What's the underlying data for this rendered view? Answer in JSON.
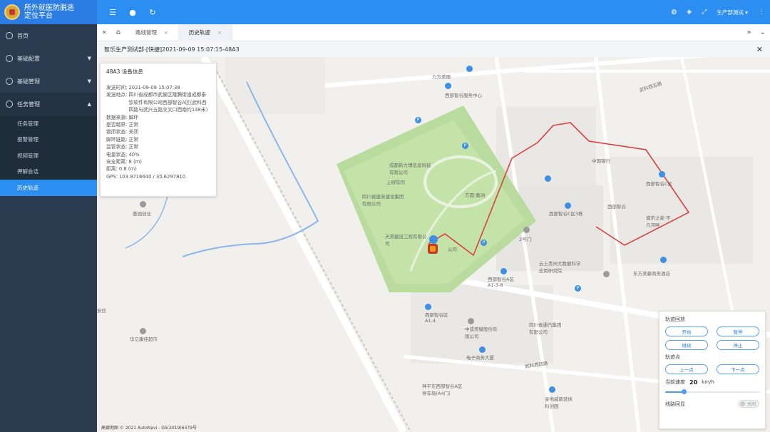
{
  "app": {
    "title_line1": "所外就医防脱逃",
    "title_line2": "定位平台"
  },
  "sidebar": {
    "items": [
      {
        "label": "首页"
      },
      {
        "label": "基础配置"
      },
      {
        "label": "基础管理"
      },
      {
        "label": "任务管理"
      }
    ],
    "submenu": [
      {
        "label": "任务管理"
      },
      {
        "label": "报警管理"
      },
      {
        "label": "视频管理"
      },
      {
        "label": "押解会话"
      },
      {
        "label": "历史轨迹"
      }
    ]
  },
  "topbar": {
    "user": "生产部测试"
  },
  "tabs": [
    {
      "label": "路线管理"
    },
    {
      "label": "历史轨迹"
    }
  ],
  "page": {
    "title": "智乐生产测试部-[快捷]2021-09-09 15:07:15-48A3"
  },
  "info": {
    "title": "48A3 设备信息",
    "rows": [
      {
        "k": "发送时间:",
        "v": "2021-09-09 15:07:38"
      },
      {
        "k": "发送地点:",
        "v": "四川省成都市武侯区隆腾街道成都泰钦软件有限公司西部智谷A区(武科西四路与武兴五路交叉口西南约148米)"
      },
      {
        "k": "数据来源:",
        "v": "脚环"
      },
      {
        "k": "是否越界:",
        "v": "正常"
      },
      {
        "k": "锁闭状态:",
        "v": "关闭"
      },
      {
        "k": "脚环链路:",
        "v": "正常"
      },
      {
        "k": "监管状态:",
        "v": "正常"
      },
      {
        "k": "电量状态:",
        "v": "40%"
      },
      {
        "k": "安全距离:",
        "v": "8 (m)"
      },
      {
        "k": "距离:",
        "v": "0.8 (m)"
      },
      {
        "k": "GPS:",
        "v": "103.9716640 / 30.6297810"
      }
    ]
  },
  "map": {
    "copyright": "高德地图 © 2021 AutoNavi - GS(2019)6379号",
    "labels": [
      "力方美丽",
      "西部智谷服务中心",
      "成都新力博信息科技有限公司",
      "上研院司",
      "四川省建安建设集团有限公司",
      "方圆·嘉洲",
      "公司",
      "天美建设工程有限公司",
      "中国银行",
      "西部智谷C区",
      "西部智谷",
      "西部智谷C区3栋",
      "城市之家·不凡河畔",
      "东方美豪商务酒店",
      "西部智谷A区A1-3-8",
      "西部智谷区A1-4",
      "中成传媒股份有限公司",
      "四川省通汽集团有限公司",
      "电子商务大厦",
      "武科西四路",
      "武科西五路",
      "神平东西部智谷A区停车场(A4门)",
      "金地威新武侯科创园",
      "华亿康佳超市",
      "荟园创业",
      "云上贵州大数据科学应用研究院",
      "2号门",
      "安信"
    ]
  },
  "panel": {
    "section1": "轨迹回放",
    "btn_start": "开始",
    "btn_pause": "暂停",
    "btn_continue": "继续",
    "btn_stop": "停止",
    "section2": "轨迹点",
    "btn_prev": "上一点",
    "btn_next": "下一点",
    "speed_label": "当前速度",
    "speed_value": "20",
    "speed_unit": "km/h",
    "speed_fraction": 0.2,
    "route_label": "线路回显",
    "route_toggle": "关闭"
  }
}
